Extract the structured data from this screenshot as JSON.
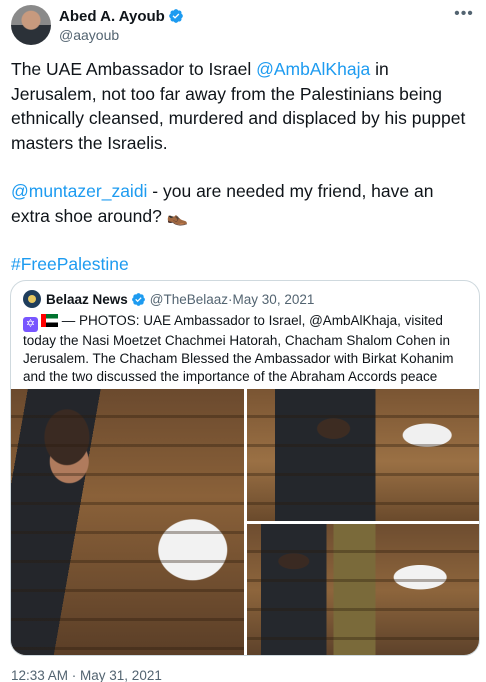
{
  "author": {
    "name": "Abed A. Ayoub",
    "handle": "@aayoub",
    "verified_icon": "verified-badge-icon",
    "more_icon": "more-options-icon"
  },
  "tweet": {
    "p1_a": "The UAE Ambassador to Israel ",
    "p1_mention": "@AmbAlKhaja",
    "p1_b": " in Jerusalem, not too far away from the Palestinians being ethnically cleansed, murdered and displaced by his puppet masters the Israelis.",
    "p2_mention": "@muntazer_zaidi",
    "p2_b": " - you are needed my friend, have an extra shoe around? 👞",
    "hashtag": "#FreePalestine"
  },
  "quoted": {
    "name": "Belaaz News",
    "handle": "@TheBelaaz",
    "separator": " · ",
    "date": "May 30, 2021",
    "text": " — PHOTOS: UAE Ambassador to Israel, @AmbAlKhaja, visited today the Nasi Moetzet Chachmei Hatorah, Chacham Shalom Cohen in Jerusalem. The Chacham Blessed the Ambassador with Birkat Kohanim and the two discussed the importance of the Abraham Accords peace agreement.",
    "photos": [
      "photo-ambassador-gift",
      "photo-ambassador-blessing",
      "photo-ambassador-frame"
    ]
  },
  "timestamp": "12:33 AM · May 31, 2021",
  "colors": {
    "link": "#1d9bf0",
    "secondary_text": "#536471",
    "border": "#cfd9de"
  }
}
